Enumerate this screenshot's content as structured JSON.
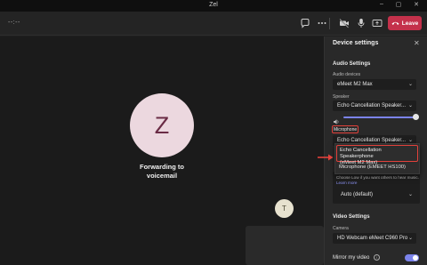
{
  "window": {
    "title": "Zel"
  },
  "toolbar": {
    "timer": "--:--",
    "leave_label": "Leave",
    "icons": [
      "chat-icon",
      "more-icon",
      "camera-icon",
      "microphone-icon",
      "share-icon",
      "leave-phone-icon"
    ],
    "leave_color": "#c4314b"
  },
  "stage": {
    "caller_initial": "Z",
    "status_line1": "Forwarding to",
    "status_line2": "voicemail",
    "self_initial": "T"
  },
  "panel": {
    "title": "Device settings",
    "audio_section": "Audio Settings",
    "audio_devices_label": "Audio devices",
    "audio_device_value": "eMeet M2 Max",
    "speaker_label": "Speaker",
    "speaker_value": "Echo Cancellation Speaker...",
    "microphone_label": "Microphone",
    "microphone_value": "Echo Cancellation Speaker...",
    "mic_menu": {
      "selected_line1": "Echo Cancellation Speakerphone",
      "selected_line2": "(eMeet M2 Max)",
      "option2": "Microphone (EMEET HS100)"
    },
    "noise_text": "Choose Low if you want others to hear music.",
    "noise_link": "Learn more",
    "noise_value": "Auto (default)",
    "video_section": "Video Settings",
    "camera_label": "Camera",
    "camera_value": "HD Webcam eMeet C960 Pro",
    "mirror_label": "Mirror my video",
    "mirror_on": true,
    "speaker_volume_fraction": 0.95,
    "accent_color": "#7b83eb",
    "highlight_color": "#e2413b"
  }
}
